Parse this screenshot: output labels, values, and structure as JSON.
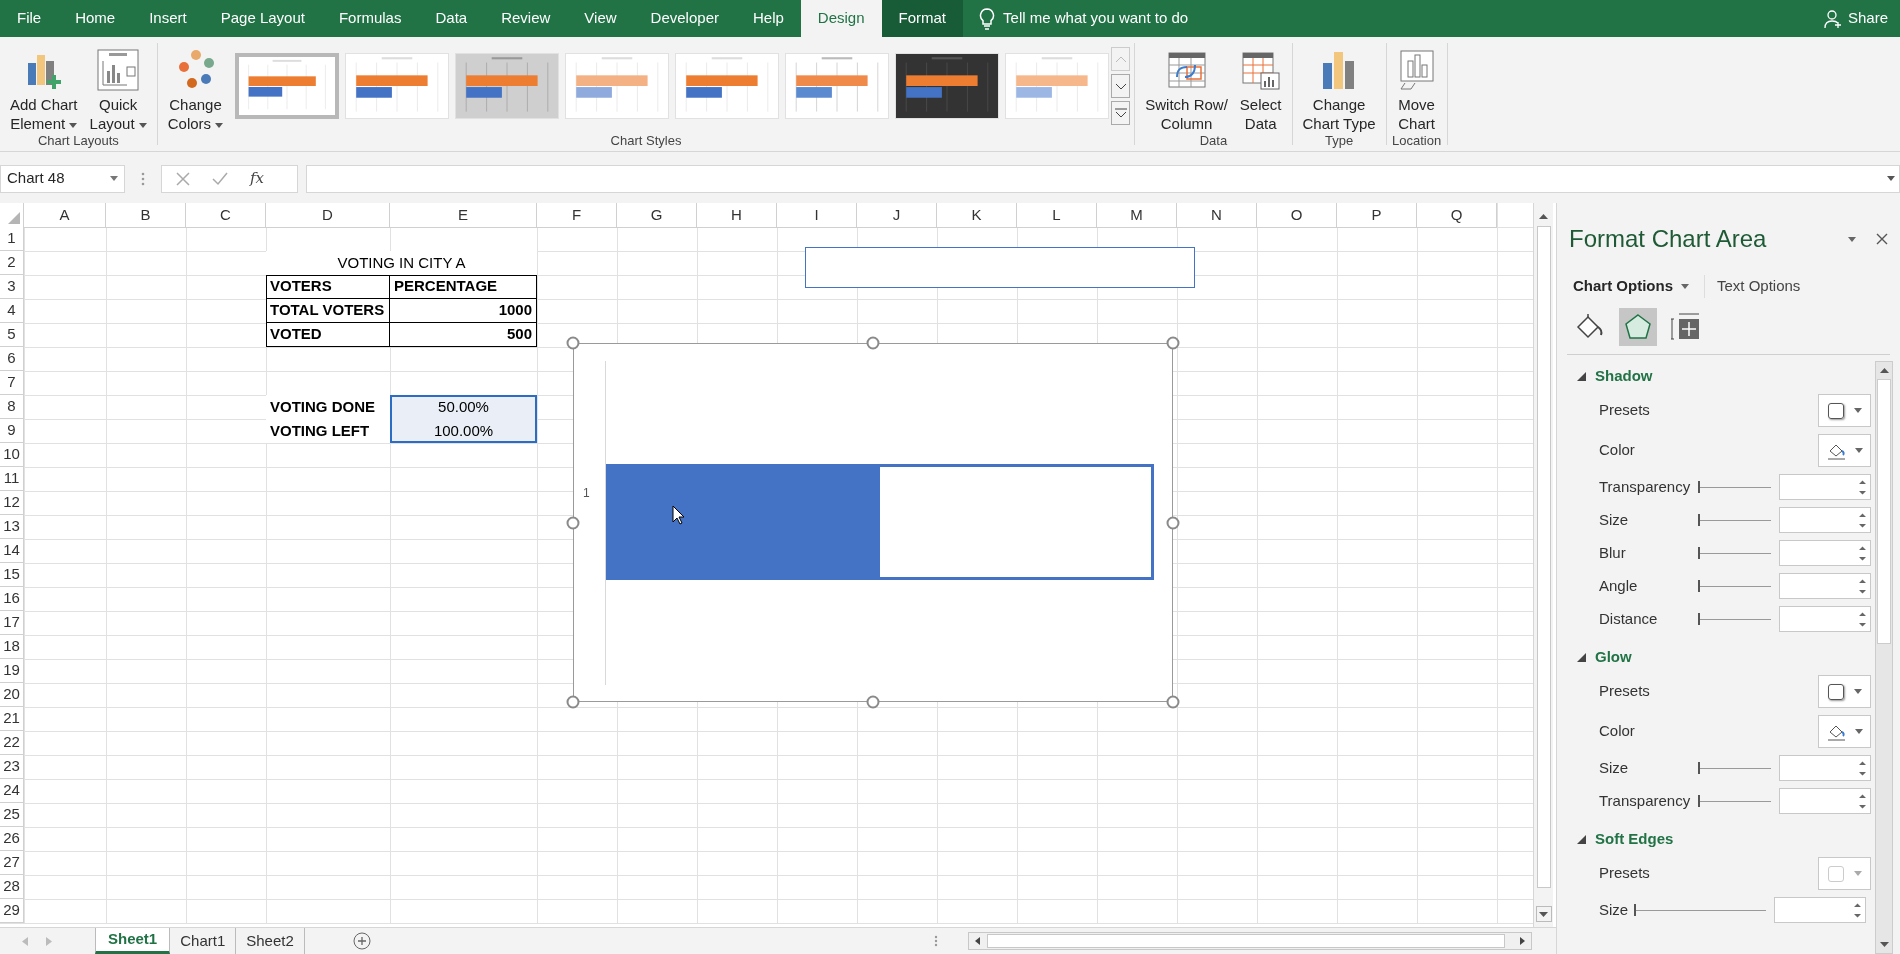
{
  "menu_tabs": [
    {
      "label": "File",
      "selected": false,
      "contextual": false
    },
    {
      "label": "Home",
      "selected": false,
      "contextual": false
    },
    {
      "label": "Insert",
      "selected": false,
      "contextual": false
    },
    {
      "label": "Page Layout",
      "selected": false,
      "contextual": false
    },
    {
      "label": "Formulas",
      "selected": false,
      "contextual": false
    },
    {
      "label": "Data",
      "selected": false,
      "contextual": false
    },
    {
      "label": "Review",
      "selected": false,
      "contextual": false
    },
    {
      "label": "View",
      "selected": false,
      "contextual": false
    },
    {
      "label": "Developer",
      "selected": false,
      "contextual": false
    },
    {
      "label": "Help",
      "selected": false,
      "contextual": false
    },
    {
      "label": "Design",
      "selected": true,
      "contextual": true
    },
    {
      "label": "Format",
      "selected": false,
      "contextual": true
    }
  ],
  "tell_me": {
    "placeholder": "Tell me what you want to do"
  },
  "share": {
    "label": "Share"
  },
  "ribbon": [
    {
      "label": "Chart Layouts",
      "buttons": [
        {
          "label_lines": [
            "Add Chart",
            "Element"
          ],
          "dropdown": true
        },
        {
          "label_lines": [
            "Quick",
            "Layout"
          ],
          "dropdown": true
        }
      ]
    },
    {
      "label": "Chart Styles",
      "buttons": [
        {
          "label_lines": [
            "Change",
            "Colors"
          ],
          "dropdown": true
        }
      ],
      "gallery": [
        {
          "kind": "plain",
          "selected": true
        },
        {
          "kind": "striped",
          "selected": false
        },
        {
          "kind": "gray",
          "selected": false
        },
        {
          "kind": "pale",
          "selected": false
        },
        {
          "kind": "plain",
          "selected": false
        },
        {
          "kind": "hatched",
          "selected": false
        },
        {
          "kind": "dark",
          "selected": false
        },
        {
          "kind": "fade",
          "selected": false
        }
      ]
    },
    {
      "label": "Data",
      "buttons": [
        {
          "label_lines": [
            "Switch Row/",
            "Column"
          ],
          "dropdown": false
        },
        {
          "label_lines": [
            "Select",
            "Data"
          ],
          "dropdown": false
        }
      ]
    },
    {
      "label": "Type",
      "buttons": [
        {
          "label_lines": [
            "Change",
            "Chart Type"
          ],
          "dropdown": false
        }
      ]
    },
    {
      "label": "Location",
      "buttons": [
        {
          "label_lines": [
            "Move",
            "Chart"
          ],
          "dropdown": false
        }
      ]
    }
  ],
  "name_box": {
    "value": "Chart 48"
  },
  "formula_bar": {
    "function_label": "fx"
  },
  "sheet": {
    "columns": [
      "A",
      "B",
      "C",
      "D",
      "E",
      "F",
      "G",
      "H",
      "I",
      "J",
      "K",
      "L",
      "M",
      "N",
      "O",
      "P",
      "Q"
    ],
    "row_headers": [
      "1",
      "2",
      "3",
      "4",
      "5",
      "6",
      "7",
      "8",
      "9",
      "10",
      "11",
      "12",
      "13",
      "14",
      "15",
      "16",
      "17",
      "18",
      "19",
      "20",
      "21",
      "22",
      "23",
      "24",
      "25",
      "26",
      "27",
      "28",
      "29"
    ],
    "title": "VOTING IN CITY A",
    "voters_table": {
      "header": [
        "VOTERS",
        "PERCENTAGE"
      ],
      "rows": [
        {
          "label": "TOTAL VOTERS",
          "value": "1000"
        },
        {
          "label": "VOTED",
          "value": "500"
        }
      ]
    },
    "results": [
      {
        "label": "VOTING DONE",
        "value": "50.00%",
        "selected": true
      },
      {
        "label": "VOTING LEFT",
        "value": "100.00%",
        "selected": true
      }
    ]
  },
  "shapes": [
    {
      "kind": "text-box"
    }
  ],
  "chart": {
    "selected": true,
    "category_label": "1"
  },
  "sheet_tabs": [
    {
      "label": "Sheet1",
      "selected": true
    },
    {
      "label": "Chart1",
      "selected": false
    },
    {
      "label": "Sheet2",
      "selected": false
    }
  ],
  "panel": {
    "title": "Format Chart Area",
    "option_tabs": [
      {
        "label": "Chart Options",
        "selected": true,
        "dropdown": true
      },
      {
        "label": "Text Options",
        "selected": false,
        "dropdown": false
      }
    ],
    "icon_tabs": [
      {
        "kind": "fill",
        "selected": false
      },
      {
        "kind": "effects",
        "selected": true
      },
      {
        "kind": "size",
        "selected": false
      }
    ],
    "sections": [
      {
        "title": "Shadow",
        "expanded": true,
        "rows": [
          {
            "kind": "preset",
            "label": "Presets"
          },
          {
            "kind": "color",
            "label": "Color"
          },
          {
            "kind": "slider",
            "label": "Transparency",
            "level": 0
          },
          {
            "kind": "slider",
            "label": "Size",
            "level": 0
          },
          {
            "kind": "slider",
            "label": "Blur",
            "level": 0
          },
          {
            "kind": "slider",
            "label": "Angle",
            "level": 0
          },
          {
            "kind": "slider",
            "label": "Distance",
            "level": 0
          }
        ]
      },
      {
        "title": "Glow",
        "expanded": true,
        "rows": [
          {
            "kind": "preset",
            "label": "Presets"
          },
          {
            "kind": "color",
            "label": "Color"
          },
          {
            "kind": "slider",
            "label": "Size",
            "level": 0
          },
          {
            "kind": "slider",
            "label": "Transparency",
            "level": 0
          }
        ]
      },
      {
        "title": "Soft Edges",
        "expanded": true,
        "rows": [
          {
            "kind": "preset",
            "label": "Presets",
            "disabled": true
          },
          {
            "kind": "slider",
            "label": "Size",
            "level": 0,
            "wide": true
          }
        ]
      }
    ]
  }
}
